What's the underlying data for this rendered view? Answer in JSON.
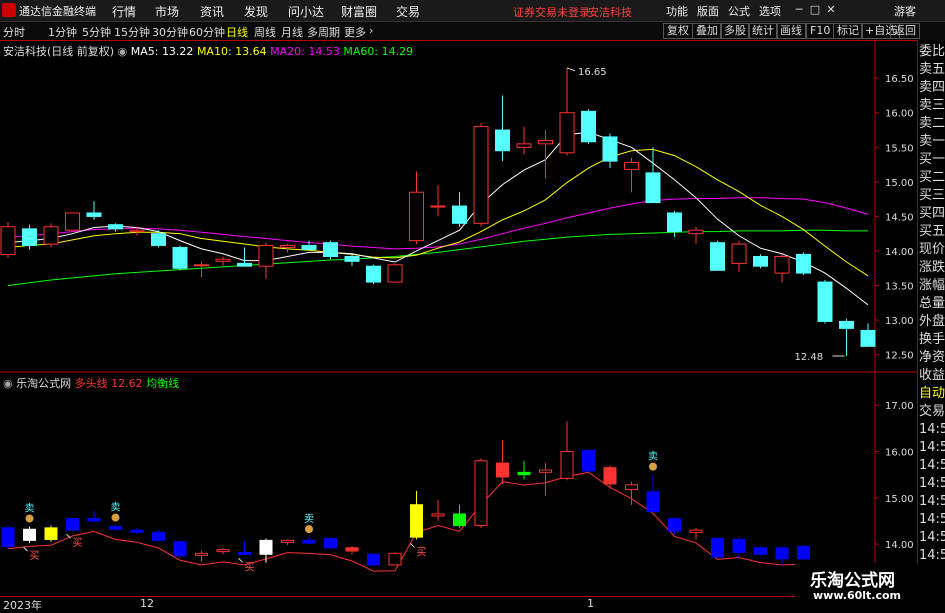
{
  "menubar": {
    "app_name": "通达信金融终端",
    "items": [
      "行情",
      "市场",
      "资讯",
      "发现",
      "问小达",
      "财富圈",
      "交易"
    ],
    "warning": "证券交易未登录",
    "stock_name": "安洁科技",
    "right_items": [
      "功能",
      "版面",
      "公式",
      "选项"
    ],
    "guest": "游客"
  },
  "toolbar": {
    "periods": [
      "分时",
      "1分钟",
      "5分钟",
      "15分钟",
      "30分钟",
      "60分钟",
      "日线",
      "周线",
      "月线",
      "多周期",
      "更多"
    ],
    "active_period": "日线",
    "buttons": [
      "复权",
      "叠加",
      "多股",
      "统计",
      "画线",
      "F10",
      "标记",
      "+自选",
      "返回"
    ]
  },
  "main_legend": {
    "title": "安洁科技(日线 前复权)",
    "ma5_label": "MA5:",
    "ma5": "13.22",
    "ma10_label": "MA10:",
    "ma10": "13.64",
    "ma20_label": "MA20:",
    "ma20": "14.53",
    "ma60_label": "MA60:",
    "ma60": "14.29"
  },
  "ind_legend": {
    "title": "乐淘公式网",
    "line1_label": "多头线",
    "line1_value": "12.62",
    "line2_label": "均衡线"
  },
  "price_axis": [
    "16.50",
    "16.00",
    "15.50",
    "15.00",
    "14.50",
    "14.00",
    "13.50",
    "13.00",
    "12.50"
  ],
  "ind_axis": [
    "17.00",
    "16.00",
    "15.00",
    "14.00"
  ],
  "annotations": {
    "high": "16.65",
    "low": "12.48",
    "buy": "买",
    "sell": "卖"
  },
  "side_panel": [
    "委比",
    "卖五",
    "卖四",
    "卖三",
    "卖二",
    "卖一",
    "买一",
    "买二",
    "买三",
    "买四",
    "买五",
    "现价",
    "涨跌",
    "涨幅",
    "总量",
    "外盘",
    "换手",
    "净资",
    "收益",
    "自动",
    "交易",
    "14:5",
    "14:5",
    "14:5",
    "14:5",
    "14:5",
    "14:5",
    "14:5",
    "14:5",
    "14:5"
  ],
  "dates": [
    "2023年",
    "12",
    "1"
  ],
  "watermark": {
    "name": "乐淘公式网",
    "url": "www.60lt.com"
  },
  "colors": {
    "up": "#ff3232",
    "down": "#54ffff",
    "ma5": "#ffffff",
    "ma10": "#ffff00",
    "ma20": "#ff00ff",
    "ma60": "#00ff00",
    "blue": "#0000ff",
    "yellow": "#ffff00",
    "green": "#00ff00"
  },
  "chart_data": {
    "type": "candlestick",
    "candles": [
      {
        "o": 13.95,
        "h": 14.42,
        "l": 13.9,
        "c": 14.35
      },
      {
        "o": 14.32,
        "h": 14.38,
        "l": 14.02,
        "c": 14.08
      },
      {
        "o": 14.1,
        "h": 14.4,
        "l": 14.05,
        "c": 14.35
      },
      {
        "o": 14.3,
        "h": 14.55,
        "l": 14.3,
        "c": 14.55
      },
      {
        "o": 14.55,
        "h": 14.72,
        "l": 14.45,
        "c": 14.5
      },
      {
        "o": 14.38,
        "h": 14.4,
        "l": 14.28,
        "c": 14.32
      },
      {
        "o": 14.28,
        "h": 14.35,
        "l": 14.22,
        "c": 14.3
      },
      {
        "o": 14.25,
        "h": 14.3,
        "l": 14.05,
        "c": 14.08
      },
      {
        "o": 14.05,
        "h": 14.08,
        "l": 13.72,
        "c": 13.75
      },
      {
        "o": 13.8,
        "h": 13.85,
        "l": 13.62,
        "c": 13.8
      },
      {
        "o": 13.85,
        "h": 13.92,
        "l": 13.78,
        "c": 13.88
      },
      {
        "o": 13.82,
        "h": 14.05,
        "l": 13.78,
        "c": 13.78
      },
      {
        "o": 13.78,
        "h": 14.12,
        "l": 13.6,
        "c": 14.08
      },
      {
        "o": 14.05,
        "h": 14.1,
        "l": 13.98,
        "c": 14.08
      },
      {
        "o": 14.08,
        "h": 14.15,
        "l": 14.02,
        "c": 14.02
      },
      {
        "o": 14.12,
        "h": 14.15,
        "l": 13.88,
        "c": 13.92
      },
      {
        "o": 13.92,
        "h": 13.95,
        "l": 13.78,
        "c": 13.85
      },
      {
        "o": 13.78,
        "h": 13.8,
        "l": 13.52,
        "c": 13.55
      },
      {
        "o": 13.55,
        "h": 13.82,
        "l": 13.55,
        "c": 13.8
      },
      {
        "o": 14.15,
        "h": 15.15,
        "l": 14.1,
        "c": 14.85
      },
      {
        "o": 14.65,
        "h": 14.95,
        "l": 14.5,
        "c": 14.65
      },
      {
        "o": 14.65,
        "h": 14.85,
        "l": 14.35,
        "c": 14.4
      },
      {
        "o": 14.4,
        "h": 15.85,
        "l": 14.35,
        "c": 15.8
      },
      {
        "o": 15.75,
        "h": 16.25,
        "l": 15.3,
        "c": 15.45
      },
      {
        "o": 15.5,
        "h": 15.8,
        "l": 15.4,
        "c": 15.55
      },
      {
        "o": 15.55,
        "h": 15.75,
        "l": 15.05,
        "c": 15.6
      },
      {
        "o": 15.42,
        "h": 16.65,
        "l": 15.38,
        "c": 16.0
      },
      {
        "o": 16.02,
        "h": 16.05,
        "l": 15.55,
        "c": 15.58
      },
      {
        "o": 15.65,
        "h": 15.7,
        "l": 15.2,
        "c": 15.3
      },
      {
        "o": 15.18,
        "h": 15.35,
        "l": 14.85,
        "c": 15.28
      },
      {
        "o": 15.13,
        "h": 15.5,
        "l": 14.7,
        "c": 14.7
      },
      {
        "o": 14.55,
        "h": 14.58,
        "l": 14.2,
        "c": 14.28
      },
      {
        "o": 14.25,
        "h": 14.35,
        "l": 14.1,
        "c": 14.3
      },
      {
        "o": 14.12,
        "h": 14.15,
        "l": 13.72,
        "c": 13.72
      },
      {
        "o": 13.82,
        "h": 14.15,
        "l": 13.7,
        "c": 14.1
      },
      {
        "o": 13.92,
        "h": 13.95,
        "l": 13.75,
        "c": 13.78
      },
      {
        "o": 13.68,
        "h": 13.95,
        "l": 13.55,
        "c": 13.92
      },
      {
        "o": 13.95,
        "h": 13.98,
        "l": 13.65,
        "c": 13.68
      },
      {
        "o": 13.55,
        "h": 13.58,
        "l": 12.95,
        "c": 12.98
      },
      {
        "o": 12.98,
        "h": 13.02,
        "l": 12.48,
        "c": 12.88
      },
      {
        "o": 12.85,
        "h": 12.95,
        "l": 12.62,
        "c": 12.62
      }
    ],
    "ma5": [
      14.12,
      14.15,
      14.18,
      14.25,
      14.34,
      14.36,
      14.34,
      14.28,
      14.15,
      14.03,
      13.96,
      13.86,
      13.86,
      13.92,
      13.98,
      13.98,
      13.96,
      13.9,
      13.84,
      14.0,
      14.15,
      14.3,
      14.68,
      14.96,
      15.17,
      15.32,
      15.68,
      15.72,
      15.61,
      15.5,
      15.27,
      15.03,
      14.77,
      14.46,
      14.22,
      14.04,
      13.96,
      13.84,
      13.68,
      13.46,
      13.22
    ],
    "ma10": [
      14.05,
      14.08,
      14.1,
      14.16,
      14.22,
      14.25,
      14.27,
      14.27,
      14.25,
      14.18,
      14.14,
      14.1,
      14.06,
      14.03,
      14.01,
      13.98,
      13.95,
      13.91,
      13.9,
      13.94,
      14.04,
      14.13,
      14.28,
      14.45,
      14.58,
      14.74,
      14.99,
      15.2,
      15.36,
      15.45,
      15.47,
      15.38,
      15.22,
      15.03,
      14.86,
      14.66,
      14.5,
      14.31,
      14.07,
      13.84,
      13.64
    ],
    "ma20": [
      14.2,
      14.22,
      14.25,
      14.28,
      14.31,
      14.32,
      14.33,
      14.32,
      14.3,
      14.27,
      14.24,
      14.21,
      14.18,
      14.15,
      14.12,
      14.1,
      14.07,
      14.05,
      14.03,
      14.04,
      14.06,
      14.1,
      14.17,
      14.25,
      14.33,
      14.4,
      14.48,
      14.55,
      14.62,
      14.68,
      14.73,
      14.75,
      14.76,
      14.76,
      14.77,
      14.77,
      14.76,
      14.75,
      14.7,
      14.62,
      14.53
    ],
    "ma60": [
      13.5,
      13.54,
      13.58,
      13.61,
      13.64,
      13.67,
      13.69,
      13.71,
      13.73,
      13.75,
      13.77,
      13.79,
      13.81,
      13.83,
      13.85,
      13.87,
      13.88,
      13.9,
      13.92,
      13.95,
      13.98,
      14.02,
      14.06,
      14.1,
      14.14,
      14.17,
      14.2,
      14.22,
      14.24,
      14.25,
      14.26,
      14.27,
      14.28,
      14.28,
      14.29,
      14.29,
      14.29,
      14.3,
      14.3,
      14.29,
      14.29
    ],
    "ind_colors": [
      "blue",
      "white",
      "yellow",
      "blue",
      "blue",
      "blue",
      "blue",
      "blue",
      "blue",
      "red",
      "red",
      "blue",
      "white",
      "red",
      "blue",
      "blue",
      "red",
      "blue",
      "red",
      "yellow",
      "red",
      "green",
      "red",
      "red",
      "green",
      "red",
      "red",
      "blue",
      "red",
      "red",
      "blue",
      "blue",
      "red",
      "blue",
      "blue",
      "blue",
      "blue",
      "blue",
      "blue",
      "blue",
      "blue"
    ],
    "buy_at": [
      1,
      3,
      11,
      19
    ],
    "sell_at": [
      1,
      5,
      14,
      30
    ],
    "ylim_main": [
      12.35,
      16.85
    ],
    "ylim_ind": [
      12.9,
      17.35
    ]
  }
}
